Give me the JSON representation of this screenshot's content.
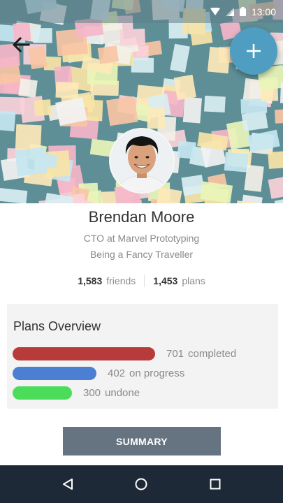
{
  "status": {
    "time": "13:00",
    "icons": [
      "wifi-icon",
      "cell-signal-icon",
      "battery-icon"
    ]
  },
  "header": {
    "back_icon": "arrow-left-icon",
    "fab_icon": "plus-icon",
    "avatar_icon": "profile-photo"
  },
  "profile": {
    "name": "Brendan Moore",
    "title": "CTO at Marvel Prototyping",
    "tagline": "Being a Fancy Traveller",
    "friends_count": "1,583",
    "friends_label": "friends",
    "plans_count": "1,453",
    "plans_label": "plans"
  },
  "plans": {
    "title": "Plans Overview",
    "rows": [
      {
        "value": "701",
        "label": "completed",
        "fraction": 0.29,
        "color": "#b83b3b"
      },
      {
        "value": "402",
        "label": "on progress",
        "fraction": 0.17,
        "color": "#4a7fd1"
      },
      {
        "value": "300",
        "label": "undone",
        "fraction": 0.12,
        "color": "#4bdc5a"
      }
    ]
  },
  "actions": {
    "summary_label": "SUMMARY"
  },
  "nav": {
    "back": "triangle-back-icon",
    "home": "circle-home-icon",
    "recents": "square-recents-icon"
  },
  "colors": {
    "fab": "#4f9ec2",
    "button": "#667381",
    "navbar": "#1e2938",
    "card": "#f3f3f3"
  }
}
